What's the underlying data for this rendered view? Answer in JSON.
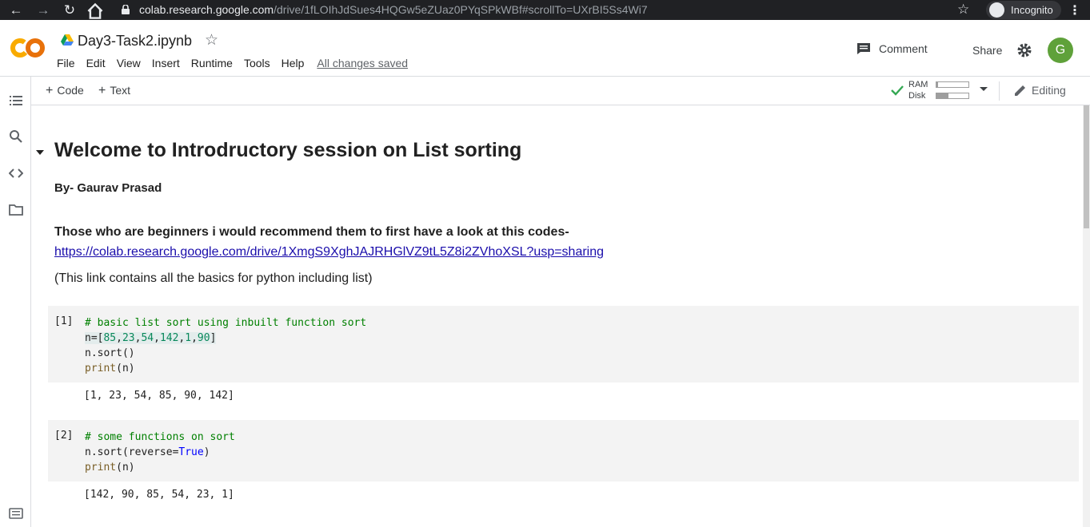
{
  "browser": {
    "url_host": "colab.research.google.com",
    "url_path": "/drive/1fLOIhJdSues4HQGw5eZUaz0PYqSPkWBf#scrollTo=UXrBI5Ss4Wi7",
    "incognito_label": "Incognito"
  },
  "header": {
    "logo_text": "CO",
    "notebook_title": "Day3-Task2.ipynb",
    "menu": [
      "File",
      "Edit",
      "View",
      "Insert",
      "Runtime",
      "Tools",
      "Help"
    ],
    "save_status": "All changes saved",
    "comment_label": "Comment",
    "share_label": "Share",
    "avatar_letter": "G",
    "avatar_color": "#5fa13a"
  },
  "toolbar": {
    "add_code": "Code",
    "add_text": "Text",
    "ram_label": "RAM",
    "disk_label": "Disk",
    "ram_usage": 0.05,
    "disk_usage": 0.38,
    "editing_label": "Editing"
  },
  "notebook": {
    "heading": "Welcome to Introdructory session on List sorting",
    "byline": "By- Gaurav Prasad",
    "intro": "Those who are beginners i would recommend them to first have a look at this codes-",
    "link": "https://colab.research.google.com/drive/1XmgS9XghJAJRHGlVZ9tL5Z8i2ZVhoXSL?usp=sharing",
    "note": "(This link contains all the basics for python including list)",
    "cells": [
      {
        "exec_count": "[1]",
        "output": "[1, 23, 54, 85, 90, 142]"
      },
      {
        "exec_count": "[2]",
        "output": "[142, 90, 85, 54, 23, 1]"
      }
    ]
  }
}
